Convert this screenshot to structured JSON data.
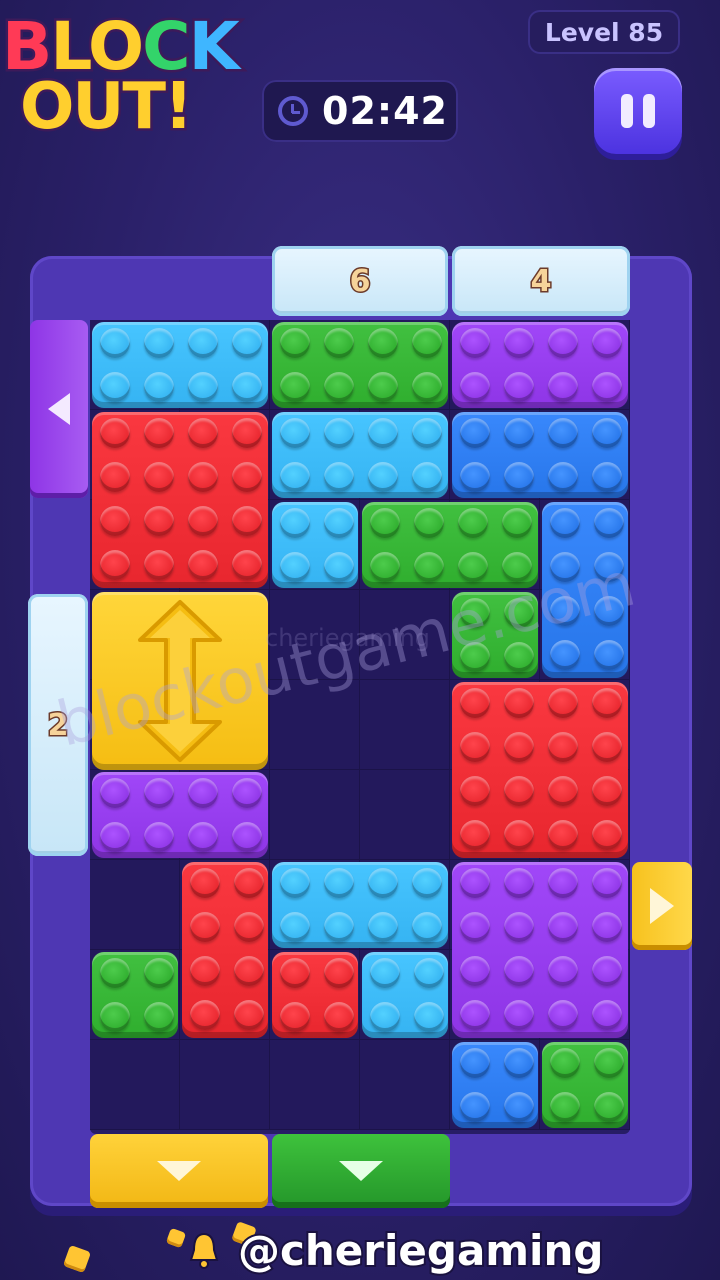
{
  "header": {
    "logo_line1": [
      "B",
      "L",
      "O",
      "C",
      "K"
    ],
    "logo_line2": "OUT!",
    "level_label": "Level 85",
    "timer": "02:42"
  },
  "ice_counters": [
    {
      "id": "top-left-ice",
      "value": "6"
    },
    {
      "id": "top-right-ice",
      "value": "4"
    },
    {
      "id": "left-ice",
      "value": "2"
    }
  ],
  "colors": {
    "red": "#e8262e",
    "blue": "#2776ea",
    "lightblue": "#35b3f2",
    "green": "#2fae2e",
    "purple": "#8e35e6",
    "yellow": "#f7c21e",
    "board": "#4e37b3"
  },
  "watermark": "blockoutgame.com",
  "watermark_faint": "cheriegaming",
  "footer": {
    "credit": "@cheriegaming"
  }
}
